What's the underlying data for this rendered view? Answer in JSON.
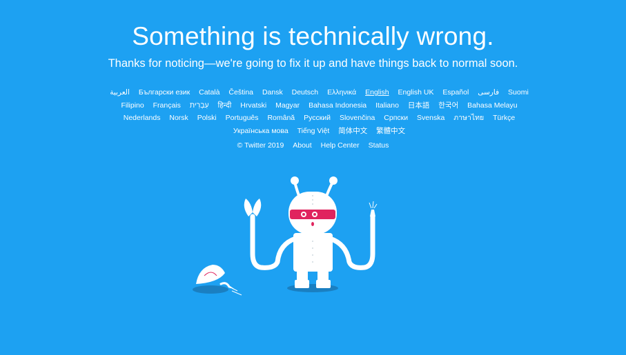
{
  "headline": "Something is technically wrong.",
  "subhead": "Thanks for noticing—we're going to fix it up and have things back to normal soon.",
  "languages": [
    {
      "label": "العربية"
    },
    {
      "label": "Български език"
    },
    {
      "label": "Català"
    },
    {
      "label": "Čeština"
    },
    {
      "label": "Dansk"
    },
    {
      "label": "Deutsch"
    },
    {
      "label": "Ελληνικά"
    },
    {
      "label": "English",
      "current": true
    },
    {
      "label": "English UK"
    },
    {
      "label": "Español"
    },
    {
      "label": "فارسی"
    },
    {
      "label": "Suomi"
    },
    {
      "label": "Filipino"
    },
    {
      "label": "Français"
    },
    {
      "label": "עִבְרִית"
    },
    {
      "label": "हिन्दी"
    },
    {
      "label": "Hrvatski"
    },
    {
      "label": "Magyar"
    },
    {
      "label": "Bahasa Indonesia"
    },
    {
      "label": "Italiano"
    },
    {
      "label": "日本語"
    },
    {
      "label": "한국어"
    },
    {
      "label": "Bahasa Melayu"
    },
    {
      "label": "Nederlands"
    },
    {
      "label": "Norsk"
    },
    {
      "label": "Polski"
    },
    {
      "label": "Português"
    },
    {
      "label": "Română"
    },
    {
      "label": "Русский"
    },
    {
      "label": "Slovenčina"
    },
    {
      "label": "Српски"
    },
    {
      "label": "Svenska"
    },
    {
      "label": "ภาษาไทย"
    },
    {
      "label": "Türkçe"
    },
    {
      "label": "Українська мова"
    },
    {
      "label": "Tiếng Việt"
    },
    {
      "label": "简体中文"
    },
    {
      "label": "繁體中文"
    }
  ],
  "footer": {
    "copyright": "© Twitter 2019",
    "about": "About",
    "help": "Help Center",
    "status": "Status"
  },
  "colors": {
    "background": "#1da1f2",
    "robot": "#ffffff",
    "shadow": "#1a7fc1",
    "visor": "#e0245e"
  },
  "illustration": "robot-icon"
}
